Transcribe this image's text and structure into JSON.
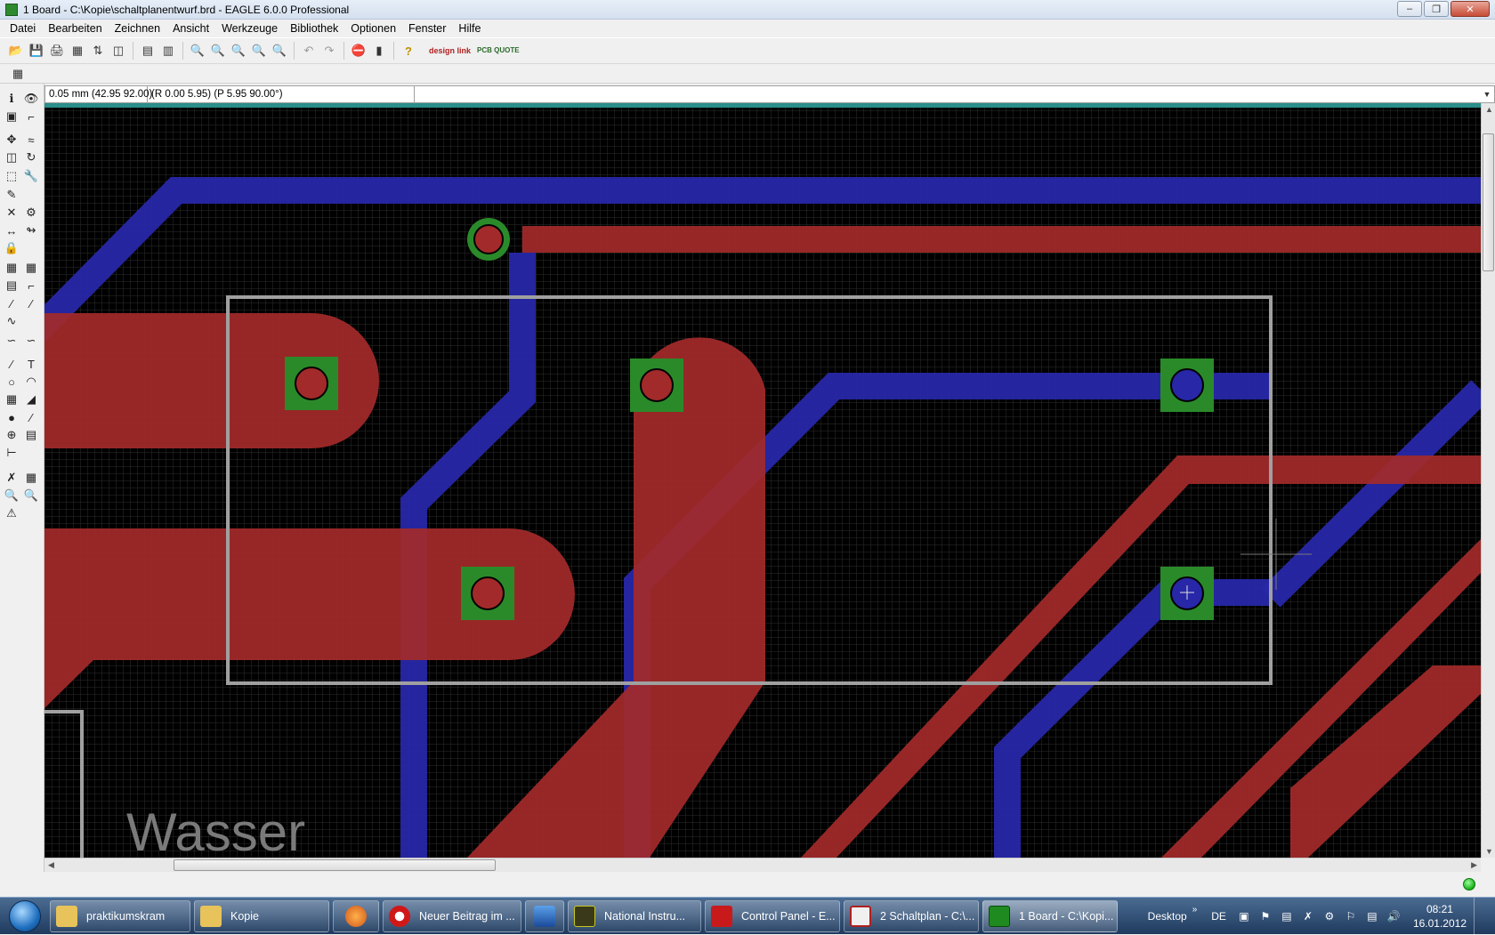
{
  "window": {
    "title": "1 Board - C:\\Kopie\\schaltplanentwurf.brd - EAGLE 6.0.0 Professional"
  },
  "menu": [
    "Datei",
    "Bearbeiten",
    "Zeichnen",
    "Ansicht",
    "Werkzeuge",
    "Bibliothek",
    "Optionen",
    "Fenster",
    "Hilfe"
  ],
  "toolbar": {
    "logo_design_link": "design link",
    "logo_pcb_quote": "PCB QUOTE"
  },
  "coords": {
    "grid": "0.05 mm (42.95 92.00)",
    "relative": "(R 0.00 5.95) (P 5.95 90.00°)"
  },
  "canvas": {
    "board_text": "Wasser"
  },
  "colors": {
    "top_layer": "#a32a2a",
    "bottom_layer": "#2727a8",
    "pad": "#2a8a2a",
    "outline": "#a0a0a0",
    "grid": "#333333",
    "background": "#000000"
  },
  "taskbar": {
    "tasks": [
      {
        "label": "praktikumskram",
        "icon": "folder-icon"
      },
      {
        "label": "Kopie",
        "icon": "folder-icon"
      },
      {
        "label": "",
        "icon": "firefox-icon"
      },
      {
        "label": "Neuer Beitrag im ...",
        "icon": "opera-icon"
      },
      {
        "label": "",
        "icon": "media-player-icon"
      },
      {
        "label": "National Instru...",
        "icon": "national-instruments-icon"
      },
      {
        "label": "Control Panel - E...",
        "icon": "eagle-icon"
      },
      {
        "label": "2 Schaltplan - C:\\...",
        "icon": "schematic-icon"
      },
      {
        "label": "1 Board - C:\\Kopi...",
        "icon": "board-icon"
      }
    ],
    "desktop_label": "Desktop",
    "language": "DE",
    "time": "08:21",
    "date": "16.01.2012"
  }
}
